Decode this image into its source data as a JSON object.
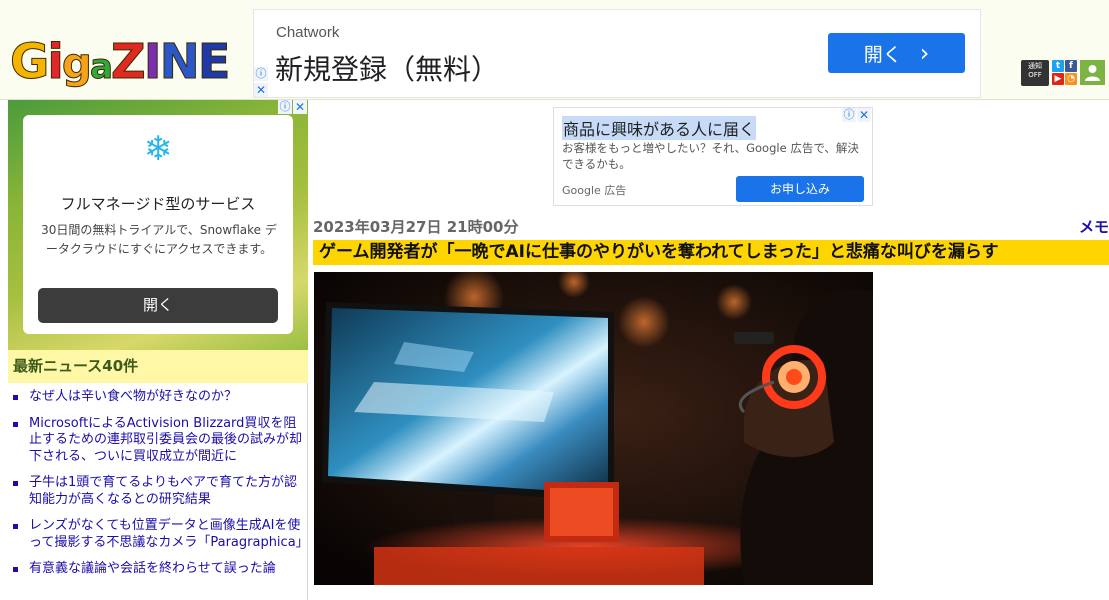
{
  "header": {
    "logo_text": "GigaZINE",
    "social": {
      "notify_label": "通知",
      "notify_state": "OFF"
    }
  },
  "ad_top": {
    "advertiser": "Chatwork",
    "headline": "新規登録（無料）",
    "button_label": "開く"
  },
  "ad_left": {
    "title": "フルマネージド型のサービス",
    "description": "30日間の無料トライアルで、Snowflake データクラウドにすぐにアクセスできます。",
    "button_label": "開く"
  },
  "news": {
    "heading": "最新ニュース40件",
    "items": [
      "なぜ人は辛い食べ物が好きなのか？",
      "MicrosoftによるActivision Blizzard買収を阻止するための連邦取引委員会の最後の試みが却下される、ついに買収成立が間近に",
      "子牛は1頭で育てるよりもペアで育てた方が認知能力が高くなるとの研究結果",
      "レンズがなくても位置データと画像生成AIを使って撮影する不思議なカメラ「Paragraphica」",
      "有意義な議論や会話を終わらせて誤った論"
    ]
  },
  "ad_mid": {
    "headline": "商品に興味がある人に届く",
    "body": "お客様をもっと増やしたい？それ、Google 広告で、解決できるかも。",
    "footer": "Google 広告",
    "button_label": "お申し込み"
  },
  "article": {
    "date": "2023年03月27日 21時00分",
    "memo_label": "メモ",
    "title": "ゲーム開発者が「一晩でAIに仕事のやりがいを奪われてしまった」と悲痛な叫びを漏らす"
  }
}
